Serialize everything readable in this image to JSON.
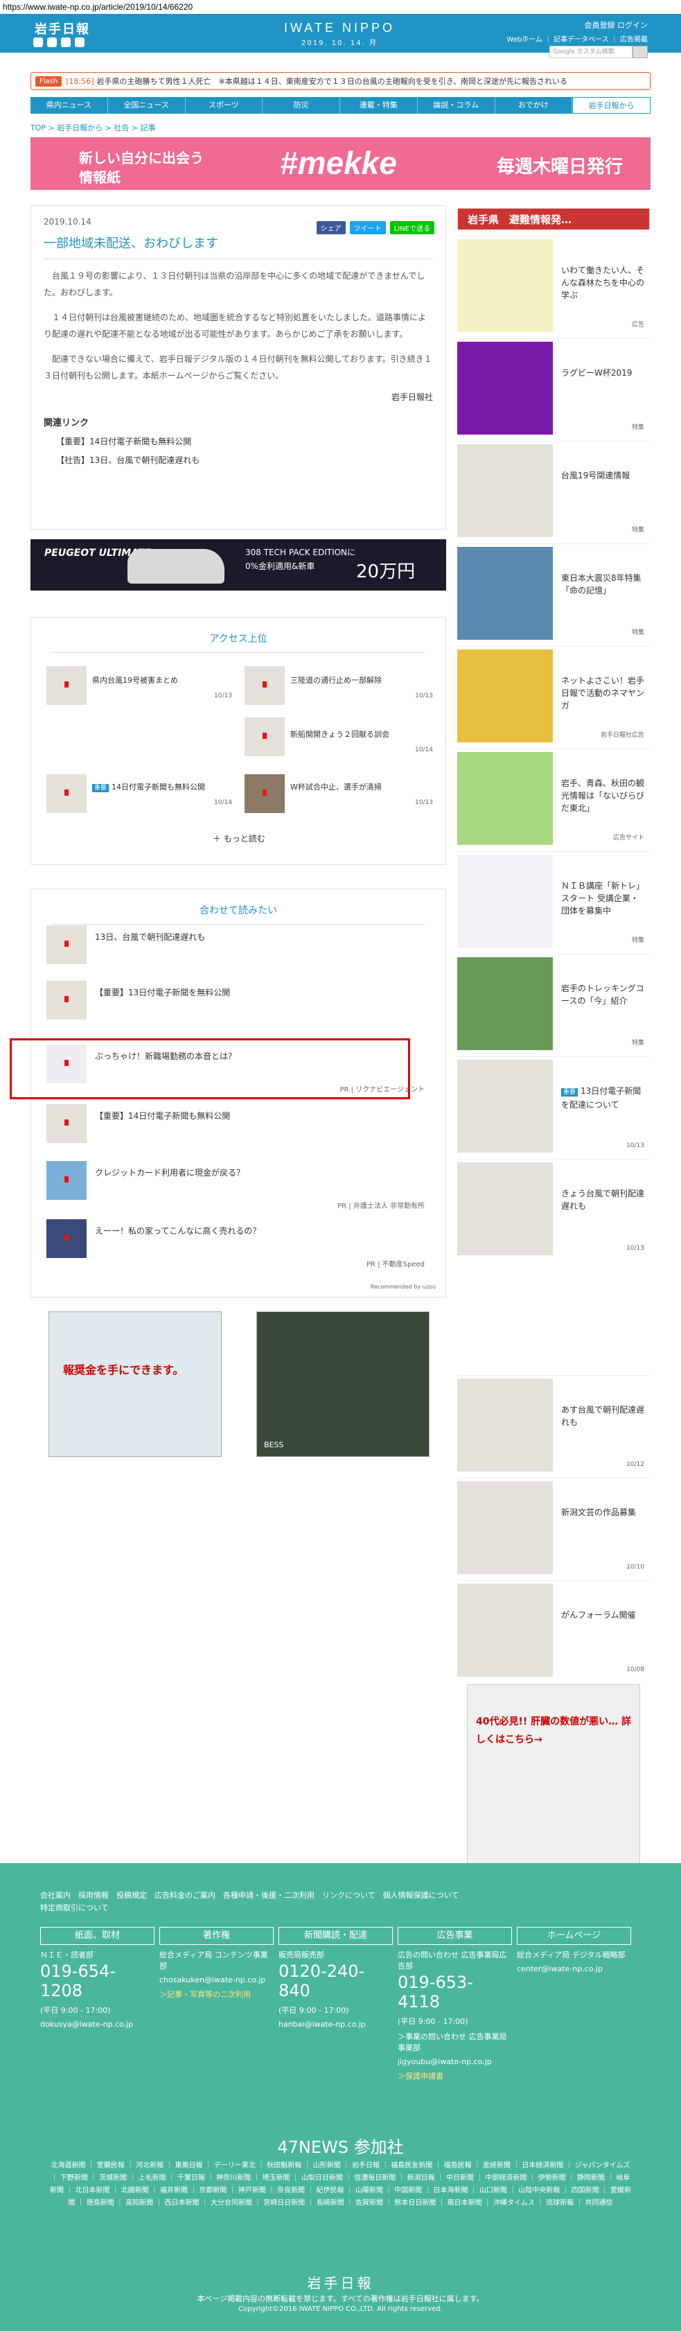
{
  "url": "https://www.iwate-np.co.jp/article/2019/10/14/66220",
  "header": {
    "logo": "岩手日報",
    "brand": "IWATE NIPPO",
    "date": "2019. 10. 14. 月",
    "links": "会員登録 ログイン",
    "links2": "Webホーム ｜ 記事データベース ｜ 広告掲載",
    "search_placeholder": "Google カスタム検索"
  },
  "flash": {
    "tag": "Flash",
    "time": "[18:56]",
    "text": "岩手県の主砲勝ちて男性１人死亡　※本県越は１４日、東南産安方で１３日の台風の主砲報向を受を引き、南岡と深途が先に報告されいる"
  },
  "nav": [
    "県内ニュース",
    "全国ニュース",
    "スポーツ",
    "防災",
    "連載・特集",
    "論説・コラム",
    "おでかけ",
    "岩手日報から"
  ],
  "breadcrumb": "TOP > 岩手日報から > 社告 > 記事",
  "banner": {
    "t1": "新しい自分に出会う",
    "t2": "情報紙",
    "mekke": "#mekke",
    "weekly": "毎週木曜日発行"
  },
  "article": {
    "date": "2019.10.14",
    "share": [
      "シェア",
      "ツイート",
      "LINEで送る"
    ],
    "title": "一部地域未配送、おわびします",
    "p1": "台風１９号の影響により、１３日付朝刊は当県の沿岸部を中心に多くの地域で配達ができませんでした。おわびします。",
    "p2": "１４日付朝刊は台風被害継続のため、地域圏を統合するなど特別処置をいたしました。道路事情により配達の遅れや配達不能となる地域が出る可能性があります。あらかじめご了承をお願いします。",
    "p3": "配達できない場合に備えて、岩手日報デジタル版の１４日付朝刊を無料公開しております。引き続き１３日付朝刊も公開します。本紙ホームページからご覧ください。",
    "source": "岩手日報社",
    "related_title": "関連リンク",
    "related": [
      "【重要】14日付電子新聞も無料公開",
      "【社告】13日、台風で朝刊配達遅れも"
    ]
  },
  "ad1": {
    "brand": "PEUGEOT ULTIMATE",
    "l1": "308 TECH PACK EDITIONに",
    "l2": "0%金利適用&新車",
    "price": "20万円"
  },
  "ranking": {
    "title": "アクセス上位",
    "items": [
      {
        "t": "県内台風19号被害まとめ",
        "d": "10/13"
      },
      {
        "t": "三陸道の通行止め一部解除",
        "d": "10/13"
      },
      {
        "t": "新船開開きょう２回献る訓会",
        "d": "10/14"
      },
      {
        "t": "重要",
        "t2": "14日付電子新聞も無料公開",
        "d": "10/14"
      },
      {
        "t": "W杯試合中止、選手が清掃",
        "d": "10/13"
      }
    ],
    "more": "＋ もっと読む"
  },
  "recommend": {
    "title": "合わせて読みたい",
    "items": [
      {
        "t": "13日、台風で朝刊配達遅れも"
      },
      {
        "t": "【重要】13日付電子新聞を無料公開"
      },
      {
        "t": "ぶっちゃけ！新職場勤務の本音とは？",
        "pr": "PR | リクナビエージェント"
      },
      {
        "t": "【重要】14日付電子新聞も無料公開"
      },
      {
        "t": "クレジットカード利用者に現金が戻る？",
        "pr": "PR | 弁護士法人 非常勤有所"
      },
      {
        "t": "えーー！私の家ってこんなに高く売れるの？",
        "pr": "PR | 不動産Speed"
      }
    ],
    "recby": "Recommended by uzou"
  },
  "ads2": {
    "a": "報奨金を手にできます。",
    "b": "BESS"
  },
  "side": {
    "head": "岩手県　避難情報発…",
    "items": [
      {
        "t": "いわて働きたい人、そんな森林たちを中心の学ぶ",
        "c": "広告"
      },
      {
        "t": "ラグビーW杯2019",
        "c": "特集"
      },
      {
        "t": "台風19号関連情報",
        "c": "特集"
      },
      {
        "t": "東日本大震災8年特集「命の記憶」",
        "c": "特集"
      },
      {
        "t": "ネットよさこい！岩手日報で活動のネマヤンガ",
        "c": "岩手日報社広告"
      },
      {
        "t": "岩手、青森、秋田の観光情報は「ないびらびだ東北」",
        "c": "広告サイト"
      },
      {
        "t": "ＮＩＢ講座「新トレ」スタート 受講企業・団体を募集中",
        "c": "特集"
      },
      {
        "t": "岩手のトレッキングコースの「今」紹介",
        "c": "特集"
      },
      {
        "t": "13日付電子新聞を配達について",
        "c": "10/13",
        "badge": "重要"
      },
      {
        "t": "きょう台風で朝刊配達遅れも",
        "c": "10/13"
      },
      {
        "t": "あす台風で朝刊配達遅れも",
        "c": "10/12"
      },
      {
        "t": "新潟文芸の作品募集",
        "c": "10/10"
      },
      {
        "t": "がんフォーラム開催",
        "c": "10/08"
      }
    ],
    "bottom_ad": "40代必見!! 肝臓の数値が悪い… 詳しくはこちら→"
  },
  "footer": {
    "links1": "会社案内　採用情報　投稿規定　広告料金のご案内　各種申請・後援・二次利用　リンクについて　個人情報保護について",
    "links2": "特定商取引について",
    "cols": [
      {
        "hd": "紙面、取材",
        "t": "ＮＩＥ・読者部",
        "ph": "019-654-1208",
        "tm": "(平日 9:00 - 17:00)",
        "em": "dokusya@iwate-np.co.jp"
      },
      {
        "hd": "著作権",
        "t": "総合メディア局 コンテンツ事業部",
        "ph": "",
        "tm": "",
        "em": "chosakuken@iwate-np.co.jp",
        "note": "＞記事・写真等の二次利用"
      },
      {
        "hd": "新聞購読・配達",
        "t": "販売局販売部",
        "ph": "0120-240-840",
        "tm": "(平日 9:00 - 17:00)",
        "em": "hanbai@iwate-np.co.jp"
      },
      {
        "hd": "広告事業",
        "t": "広告の問い合わせ 広告事業局広告部",
        "ph": "019-653-4118",
        "tm": "(平日 9:00 - 17:00)",
        "em": "jigyoubu@iwate-np.co.jp",
        "note": "＞事業の問い合わせ 広告事業局事業部",
        "note2": "＞保護申請書"
      },
      {
        "hd": "ホームページ",
        "t": "総合メディア局 デジタル戦略部",
        "ph": "",
        "tm": "",
        "em": "center@iwate-np.co.jp"
      }
    ],
    "news47": "47NEWS 参加社",
    "papers": "北海道新聞 ｜ 室蘭民報 ｜ 河北新報 ｜ 東奥日報 ｜ デーリー東北 ｜ 秋田魁新報 ｜ 山形新聞 ｜ 岩手日報 ｜ 福島民友新聞 ｜ 福島民報 ｜ 産経新聞 ｜ 日本経済新聞 ｜ ジャパンタイムズ ｜ 下野新聞 ｜ 茨城新聞 ｜ 上毛新聞 ｜ 千葉日報 ｜ 神奈川新聞 ｜ 埼玉新聞 ｜ 山梨日日新聞 ｜ 信濃毎日新聞 ｜ 新潟日報 ｜ 中日新聞 ｜ 中部経済新聞 ｜ 伊勢新聞 ｜ 静岡新聞 ｜ 岐阜新聞 ｜ 北日本新聞 ｜ 北國新聞 ｜ 福井新聞 ｜ 京都新聞 ｜ 神戸新聞 ｜ 奈良新聞 ｜ 紀伊民報 ｜ 山陽新聞 ｜ 中国新聞 ｜ 日本海新聞 ｜ 山口新聞 ｜ 山陰中央新報 ｜ 四国新聞 ｜ 愛媛新聞 ｜ 徳島新聞 ｜ 高知新聞 ｜ 西日本新聞 ｜ 大分合同新聞 ｜ 宮崎日日新聞 ｜ 長崎新聞 ｜ 佐賀新聞 ｜ 熊本日日新聞 ｜ 南日本新聞 ｜ 沖縄タイムス ｜ 琉球新報 ｜ 共同通信",
    "logo": "岩手日報",
    "copy1": "本ページ掲載内容の無断転載を禁じます。すべての著作権は岩手日報社に属します。",
    "copy2": "Copyright©2016 IWATE NIPPO CO.,LTD. All rights reserved."
  }
}
